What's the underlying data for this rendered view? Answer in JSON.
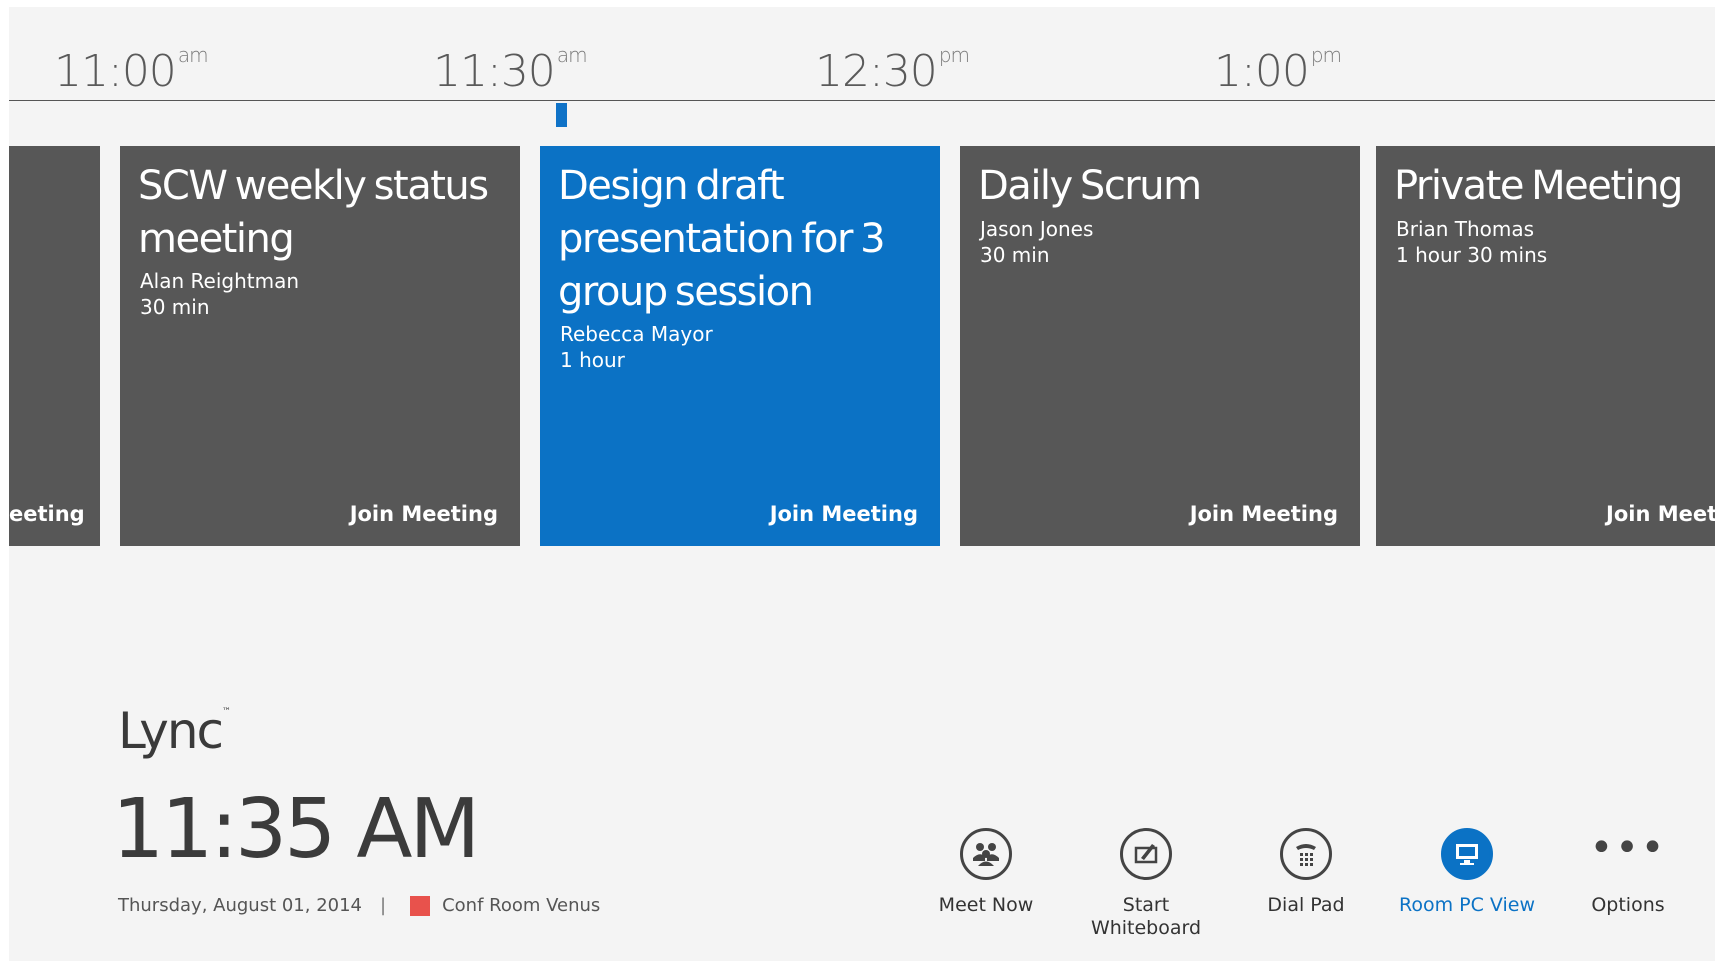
{
  "timeline": {
    "labels": [
      {
        "time": "11:00",
        "ampm": "am"
      },
      {
        "time": "11:30",
        "ampm": "am"
      },
      {
        "time": "12:30",
        "ampm": "pm"
      },
      {
        "time": "1:00",
        "ampm": "pm"
      }
    ]
  },
  "meetings": [
    {
      "title": "",
      "organizer": "",
      "duration": "",
      "join_label": "Join Meeting",
      "partial_visible_text": "eeting"
    },
    {
      "title": "SCW weekly status meeting",
      "organizer": "Alan Reightman",
      "duration": "30 min",
      "join_label": "Join Meeting"
    },
    {
      "title": "Design draft presentation for 3 group session",
      "organizer": "Rebecca Mayor",
      "duration": "1 hour",
      "join_label": "Join Meeting"
    },
    {
      "title": "Daily Scrum",
      "organizer": "Jason Jones",
      "duration": "30 min",
      "join_label": "Join Meeting"
    },
    {
      "title": "Private Meeting",
      "organizer": "Brian Thomas",
      "duration": "1 hour 30 mins",
      "join_label": "Join Meetin"
    }
  ],
  "brand": {
    "name": "Lync",
    "mark": "™"
  },
  "clock": {
    "time": "11:35 AM",
    "date": "Thursday, August 01, 2014",
    "separator": "|",
    "room": "Conf Room Venus"
  },
  "actions": [
    {
      "label": "Meet Now",
      "icon": "people-icon"
    },
    {
      "label": "Start\nWhiteboard",
      "icon": "whiteboard-icon"
    },
    {
      "label": "Dial Pad",
      "icon": "dialpad-icon"
    },
    {
      "label": "Room PC View",
      "icon": "monitor-icon"
    },
    {
      "label": "Options",
      "icon": "more-icon"
    }
  ],
  "colors": {
    "accent": "#0b72c5",
    "tile": "#575757",
    "room_status": "#e8524c"
  }
}
